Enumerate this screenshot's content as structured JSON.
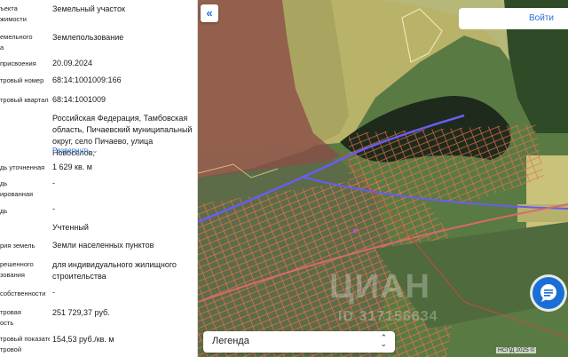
{
  "info_panel": {
    "rows": [
      {
        "label": "ъекта\nжимости",
        "value": "Земельный участок"
      },
      {
        "label": "емельного\nа",
        "value": "Землепользование"
      },
      {
        "label": "присвоения",
        "value": "20.09.2024"
      },
      {
        "label": "тровый номер",
        "value": "68:14:1001009:166"
      },
      {
        "label": "тровый квартал",
        "value": "68:14:1001009"
      },
      {
        "label": "",
        "value": "Российская Федерация, Тамбовская область, Пичаевский муниципальный округ, село Пичаево, улица Новоселов,"
      },
      {
        "label": "дь уточненная",
        "value": "1 629 кв. м"
      },
      {
        "label": "дь\nированная",
        "value": "-"
      },
      {
        "label": "дь",
        "value": "-"
      },
      {
        "label": "",
        "value": "Учтенный"
      },
      {
        "label": "рия земель",
        "value": "Земли населенных пунктов"
      },
      {
        "label": "решенного\nзования",
        "value": "для индивидуального жилищного строительства"
      },
      {
        "label": "собственности",
        "value": "-"
      },
      {
        "label": "тровая\nость",
        "value": "251 729,37 руб."
      },
      {
        "label": "тровый показатель\nтровой",
        "value": "154,53 руб./кв. м"
      }
    ],
    "expand_link": "Развернуть"
  },
  "map": {
    "back_button": "«",
    "login_button": "Войти",
    "legend_label": "Легенда",
    "legend_toggle": "⌃⌄",
    "copyright": "НСПД 2025 ©",
    "watermark": "ЦИАН",
    "watermark_id": "ID 317156634"
  },
  "colors": {
    "accent": "#2b6fd6",
    "parcel_outline": "#e8734a",
    "boundary_line": "#6a5cf0"
  }
}
